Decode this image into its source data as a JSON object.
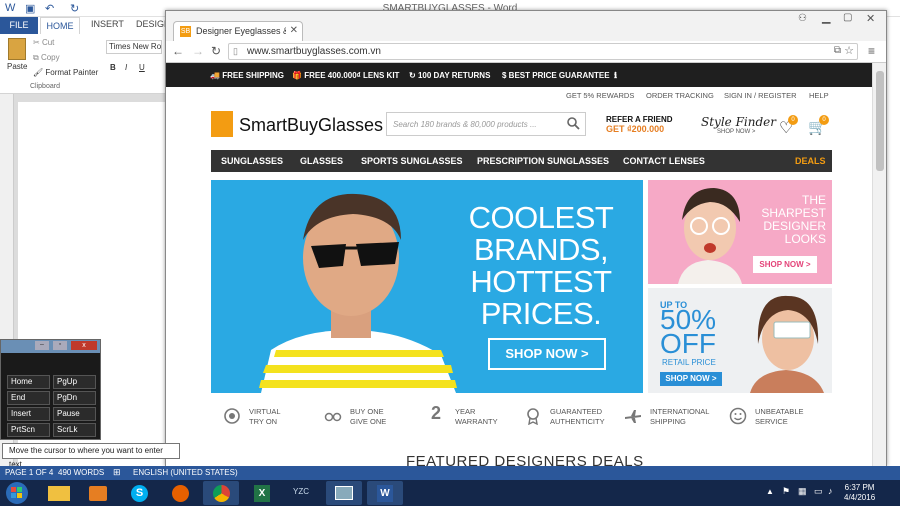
{
  "word": {
    "title": "SMARTBUYGLASSES - Word",
    "tabs": {
      "file": "FILE",
      "home": "HOME",
      "insert": "INSERT",
      "design": "DESIGN"
    },
    "clipboard": {
      "paste": "Paste",
      "cut": "Cut",
      "copy": "Copy",
      "format_painter": "Format Painter",
      "group": "Clipboard"
    },
    "font": {
      "name": "Times New Ro",
      "bold": "B",
      "italic": "I",
      "underline": "U"
    },
    "status": {
      "page": "PAGE 1 OF 4",
      "words": "490 WORDS",
      "language": "ENGLISH (UNITED STATES)"
    }
  },
  "chrome": {
    "tab_title": "Designer Eyeglasses & Su",
    "url": "www.smartbuyglasses.com.vn"
  },
  "site": {
    "benefits_bar": [
      "FREE SHIPPING",
      "FREE 400.000₫ LENS KIT",
      "100 DAY RETURNS",
      "BEST PRICE GUARANTEE"
    ],
    "top_links": [
      "GET 5% REWARDS",
      "ORDER TRACKING",
      "SIGN IN / REGISTER",
      "HELP"
    ],
    "logo": "SmartBuyGlasses",
    "search_placeholder": "Search 180 brands & 80,000 products ...",
    "refer": {
      "line1": "REFER A FRIEND",
      "line2": "GET ₫200.000"
    },
    "style_finder": {
      "title": "Style Finder",
      "sub": "SHOP NOW >"
    },
    "wishlist_count": "0",
    "cart_count": "0",
    "nav": [
      "SUNGLASSES",
      "GLASSES",
      "SPORTS SUNGLASSES",
      "PRESCRIPTION SUNGLASSES",
      "CONTACT LENSES",
      "DEALS"
    ],
    "hero": {
      "lines": [
        "COOLEST",
        "BRANDS,",
        "HOTTEST",
        "PRICES."
      ],
      "button": "SHOP NOW >"
    },
    "banner_designer": {
      "lines": [
        "THE",
        "SHARPEST",
        "DESIGNER",
        "LOOKS"
      ],
      "button": "SHOP NOW >"
    },
    "banner_contacts": {
      "up_to": "UP TO",
      "percent": "50%",
      "off": "OFF",
      "retail": "RETAIL PRICE",
      "button": "SHOP NOW >"
    },
    "benefits": [
      {
        "l1": "VIRTUAL",
        "l2": "TRY ON"
      },
      {
        "l1": "BUY ONE",
        "l2": "GIVE ONE"
      },
      {
        "l1": "YEAR",
        "l2": "WARRANTY",
        "num": "2"
      },
      {
        "l1": "GUARANTEED",
        "l2": "AUTHENTICITY"
      },
      {
        "l1": "INTERNATIONAL",
        "l2": "SHIPPING"
      },
      {
        "l1": "UNBEATABLE",
        "l2": "SERVICE"
      }
    ],
    "featured": "FEATURED DESIGNERS DEALS"
  },
  "osk": {
    "keys": [
      "Home",
      "PgUp",
      "End",
      "PgDn",
      "Insert",
      "Pause",
      "PrtScn",
      "ScrLk"
    ]
  },
  "tooltip": "Move the cursor to where you want to enter text.",
  "taskbar": {
    "time": "6:37 PM",
    "date": "4/4/2016"
  }
}
